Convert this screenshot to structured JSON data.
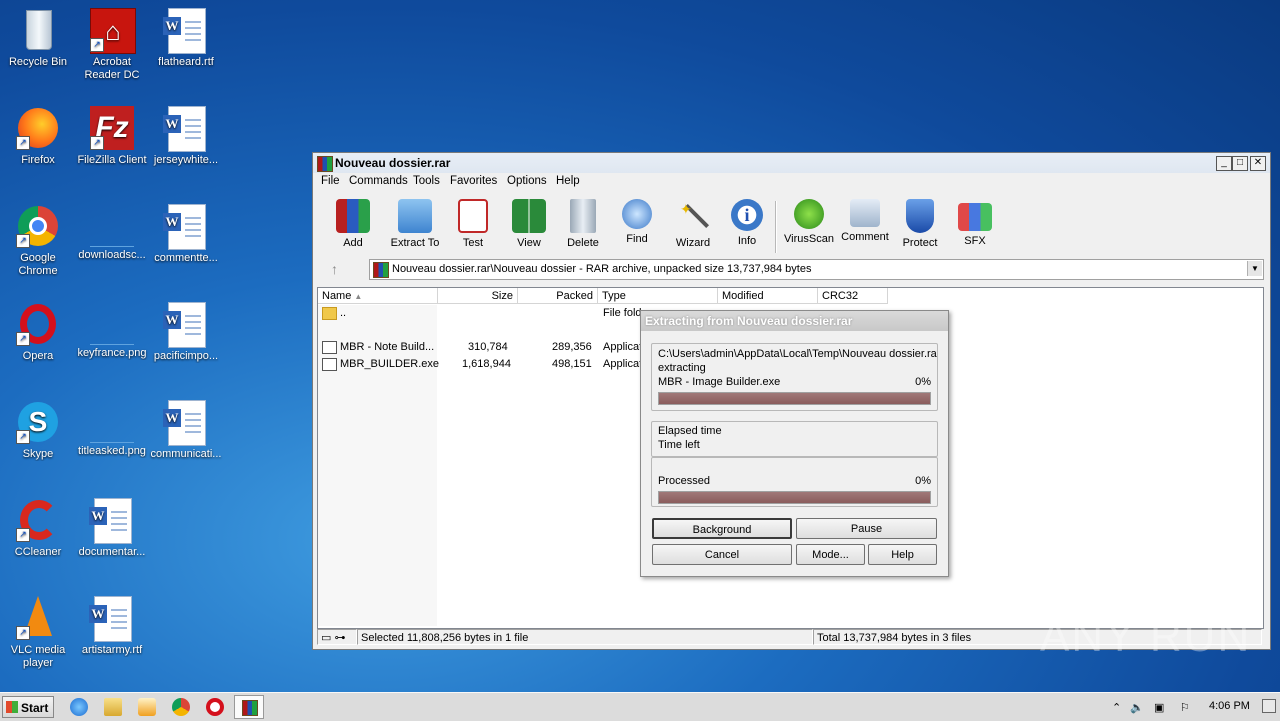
{
  "desktop": {
    "icons": [
      {
        "label": "Recycle Bin"
      },
      {
        "label": "Acrobat Reader DC"
      },
      {
        "label": "flatheard.rtf"
      },
      {
        "label": "Firefox"
      },
      {
        "label": "FileZilla Client"
      },
      {
        "label": "jerseywhite..."
      },
      {
        "label": "Google Chrome"
      },
      {
        "label": "downloadsc..."
      },
      {
        "label": "commentte..."
      },
      {
        "label": "Opera"
      },
      {
        "label": "keyfrance.png"
      },
      {
        "label": "pacificimpo..."
      },
      {
        "label": "Skype"
      },
      {
        "label": "titleasked.png"
      },
      {
        "label": "communicati..."
      },
      {
        "label": "CCleaner"
      },
      {
        "label": "documentar..."
      },
      {
        "label": "VLC media player"
      },
      {
        "label": "artistarmy.rtf"
      }
    ]
  },
  "window": {
    "title": "Nouveau dossier.rar",
    "menu": [
      "File",
      "Commands",
      "Tools",
      "Favorites",
      "Options",
      "Help"
    ],
    "toolbar": [
      "Add",
      "Extract To",
      "Test",
      "View",
      "Delete",
      "Find",
      "Wizard",
      "Info",
      "VirusScan",
      "Comment",
      "Protect",
      "SFX"
    ],
    "path": "Nouveau dossier.rar\\Nouveau dossier - RAR archive, unpacked size 13,737,984 bytes",
    "columns": [
      "Name",
      "Size",
      "Packed",
      "Type",
      "Modified",
      "CRC32"
    ],
    "rows": [
      {
        "name": "..",
        "size": "",
        "packed": "",
        "type": "File fold"
      },
      {
        "name": "MBR - Note Build...",
        "size": "310,784",
        "packed": "289,356",
        "type": "Applicat"
      },
      {
        "name": "MBR_BUILDER.exe",
        "size": "1,618,944",
        "packed": "498,151",
        "type": "Applicat"
      }
    ],
    "status_left": "Selected 11,808,256 bytes in 1 file",
    "status_right": "Total 13,737,984 bytes in 3 files"
  },
  "dialog": {
    "title": "Extracting from Nouveau dossier.rar",
    "path": "C:\\Users\\admin\\AppData\\Local\\Temp\\Nouveau dossier.ra",
    "action": "extracting",
    "file": "MBR - Image Builder.exe",
    "file_pct": "0%",
    "file_progress": 1.0,
    "elapsed_label": "Elapsed time",
    "left_label": "Time left",
    "processed_label": "Processed",
    "processed_pct": "0%",
    "processed_progress": 1.0,
    "buttons": {
      "background": "Background",
      "pause": "Pause",
      "cancel": "Cancel",
      "mode": "Mode...",
      "help": "Help"
    }
  },
  "taskbar": {
    "start": "Start",
    "clock": "4:06 PM"
  },
  "watermark": "ANY RUN"
}
